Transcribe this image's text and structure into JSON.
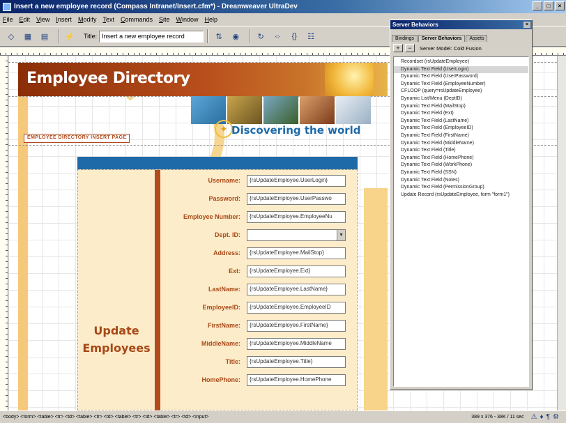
{
  "window": {
    "title": "Insert a new employee record (Compass Intranet/Insert.cfm*) - Dreamweaver UltraDev"
  },
  "menus": [
    "File",
    "Edit",
    "View",
    "Insert",
    "Modify",
    "Text",
    "Commands",
    "Site",
    "Window",
    "Help"
  ],
  "toolbar": {
    "title_label": "Title:",
    "title_value": "Insert a new employee record"
  },
  "page": {
    "banner_title": "Employee Directory",
    "tagline": "Discovering the world",
    "insert_label": "EMPLOYEE DIRECTORY INSERT PAGE",
    "side_heading_line1": "Update",
    "side_heading_line2": "Employees"
  },
  "form_rows": [
    {
      "label": "Username:",
      "value": "{rsUpdateEmployee.UserLogin}"
    },
    {
      "label": "Password:",
      "value": "{rsUpdateEmployee.UserPasswo"
    },
    {
      "label": "Employee Number:",
      "value": "{rsUpdateEmployee.EmployeeNu"
    },
    {
      "label": "Dept. ID:",
      "value": ""
    },
    {
      "label": "Address:",
      "value": "{rsUpdateEmployee.MailStop}"
    },
    {
      "label": "Ext:",
      "value": "{rsUpdateEmployee.Ext}"
    },
    {
      "label": "LastName:",
      "value": "{rsUpdateEmployee.LastName}"
    },
    {
      "label": "EmployeeID:",
      "value": "{rsUpdateEmployee.EmployeeID"
    },
    {
      "label": "FirstName:",
      "value": "{rsUpdateEmployee.FirstName}"
    },
    {
      "label": "MiddleName:",
      "value": "{rsUpdateEmployee.MiddleName"
    },
    {
      "label": "Title:",
      "value": "{rsUpdateEmployee.Title}"
    },
    {
      "label": "HomePhone:",
      "value": "{rsUpdateEmployee.HomePhone"
    }
  ],
  "panel": {
    "title": "Server Behaviors",
    "tabs": [
      "Bindings",
      "Server Behaviors",
      "Assets"
    ],
    "add_button": "+",
    "remove_button": "−",
    "server_model": "Server Model: Cold Fusion",
    "behaviors": [
      "Recordset (rsUpdateEmployee)",
      "Dynamic Text Field (UserLogin)",
      "Dynamic Text Field (UserPassword)",
      "Dynamic Text Field (EmployeeNumber)",
      "CFLOOP (query=rsUpdateEmployee)",
      "Dynamic List/Menu (DeptID)",
      "Dynamic Text Field (MailStop)",
      "Dynamic Text Field (Ext)",
      "Dynamic Text Field (LastName)",
      "Dynamic Text Field (EmployeeID)",
      "Dynamic Text Field (FirstName)",
      "Dynamic Text Field (MiddleName)",
      "Dynamic Text Field (Title)",
      "Dynamic Text Field (HomePhone)",
      "Dynamic Text Field (WorkPhone)",
      "Dynamic Text Field (SSN)",
      "Dynamic Text Field (Notes)",
      "Dynamic Text Field (PermissionGroup)",
      "Update Record (rsUpdateEmployee, form \"form1\")"
    ],
    "selected_index": 1
  },
  "status": {
    "tag_path": "<body> <form> <table> <tr> <td> <table> <tr> <td> <table> <tr> <td> <table> <tr> <td> <input>",
    "size": "389 x 376 - 38K / 11 sec"
  },
  "colors": {
    "accent_brown": "#b24a1a",
    "accent_blue": "#1e6aa8",
    "form_bg": "#fcecc9"
  }
}
